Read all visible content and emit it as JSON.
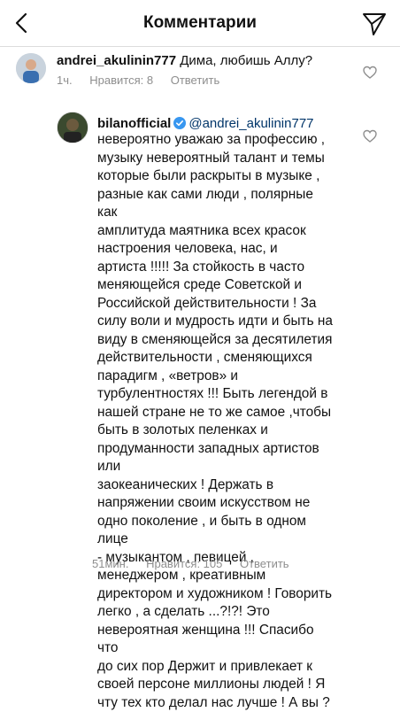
{
  "header": {
    "title": "Комментарии"
  },
  "comment_1": {
    "username": "andrei_akulinin777",
    "text": "Дима, любишь Аллу?",
    "time": "1ч.",
    "likes": "Нравится: 8",
    "reply": "Ответить"
  },
  "comment_2": {
    "username": "bilanofficial",
    "mention": "@andrei_akulinin777",
    "text": "невероятно уважаю за профессию ,\nмузыку невероятный талант и темы\nкоторые были раскрыты в музыке ,\nразные как сами люди , полярные как\nамплитуда маятника всех красок\nнастроения человека, нас,  и\nартиста !!!!! За стойкость в часто\nменяющейся среде Советской  и\nРоссийской действительности ! За\nсилу воли и мудрость идти и быть на\nвиду в сменяющейся за десятилетия\nдействительности , сменяющихся\nпарадигм , «ветров» и\nтурбулентностях !!! Быть легендой в\nнашей стране не то же самое ,чтобы\nбыть в золотых пеленках и\nпродуманности западных артистов или\nзаокеанических ! Держать в\nнапряжении своим искусством не\nодно поколение , и быть в одном лице\n- музыкантом , певицей ,\nменеджером , креативным\nдиректором и художником ! Говорить\nлегко , а сделать ...?!?! Это\nневероятная женщина !!! Спасибо что\nдо сих пор Держит и привлекает к\nсвоей персоне миллионы людей ! Я\nчту тех кто делал нас лучше ! А вы ?",
    "time": "51мин.",
    "likes": "Нравится: 105",
    "reply": "Ответить"
  }
}
